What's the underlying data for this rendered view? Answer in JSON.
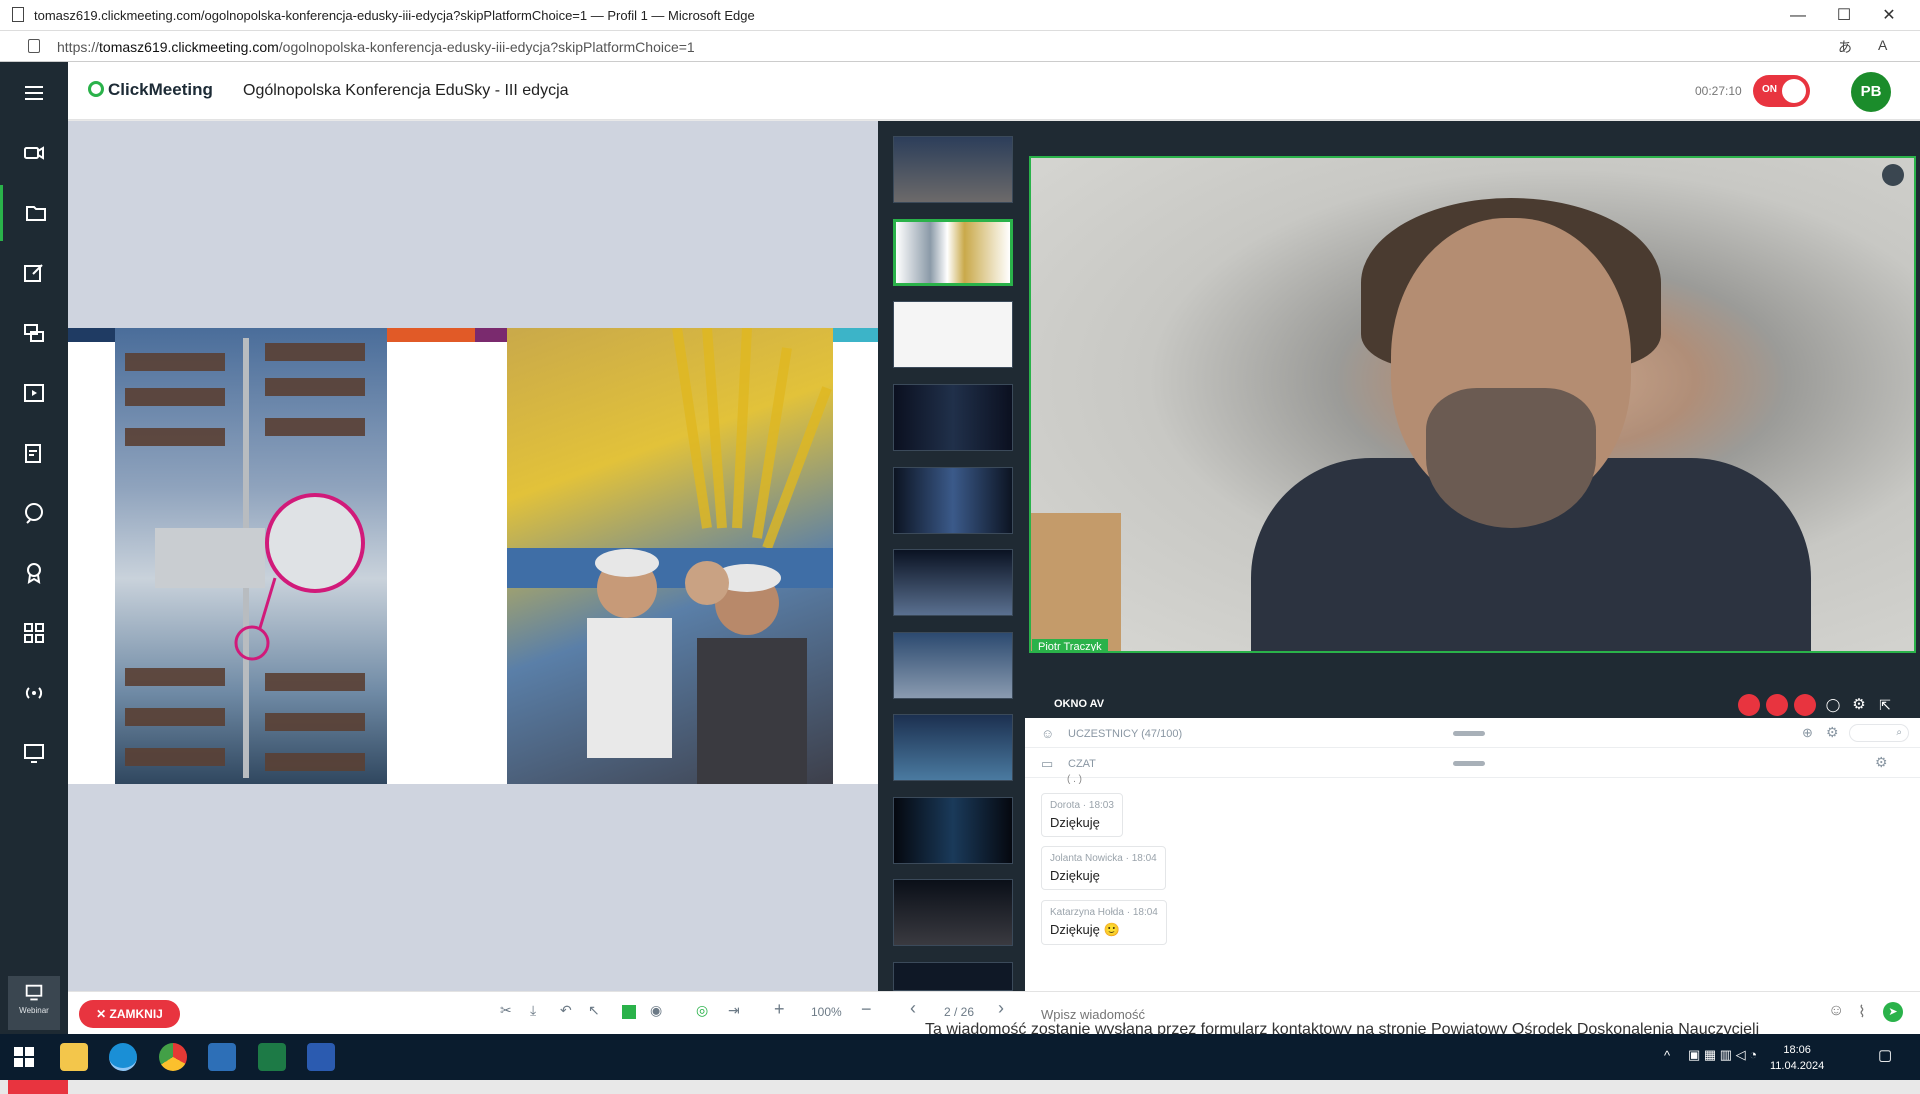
{
  "browser": {
    "title": "tomasz619.clickmeeting.com/ogolnopolska-konferencja-edusky-iii-edycja?skipPlatformChoice=1 — Profil 1 — Microsoft Edge",
    "url_scheme": "https://",
    "url_host": "tomasz619.clickmeeting.com",
    "url_path": "/ogolnopolska-konferencja-edusky-iii-edycja?skipPlatformChoice=1",
    "minimize": "—",
    "maximize": "☐",
    "close": "✕"
  },
  "header": {
    "logo": "ClickMeeting",
    "event_title": "Ogólnopolska Konferencja EduSky - III edycja",
    "timer": "00:27:10",
    "toggle_label": "ON",
    "avatar_initials": "PB"
  },
  "sidebar": {
    "items": [
      "menu",
      "camera",
      "files",
      "edit",
      "layers",
      "media",
      "survey",
      "qa",
      "badge",
      "apps",
      "broadcast",
      "screen"
    ],
    "webinar_label": "Webinar"
  },
  "presentation": {
    "slide_colors": [
      "#1f3b63",
      "#e15a27",
      "#7a2a6e",
      "#3cb4c8"
    ]
  },
  "video": {
    "participant_name": "Piotr Traczyk"
  },
  "av_panel": {
    "label": "OKNO AV"
  },
  "participants": {
    "label": "UCZESTNICY (47/100)"
  },
  "chat": {
    "label": "CZAT",
    "partial_top": "( . )",
    "messages": [
      {
        "author": "Dorota",
        "time": "18:03",
        "text": "Dziękuję"
      },
      {
        "author": "Jolanta Nowicka",
        "time": "18:04",
        "text": "Dziękuję"
      },
      {
        "author": "Katarzyna Hołda",
        "time": "18:04",
        "text": "Dziękuję",
        "emoji": "🙂"
      }
    ],
    "input_placeholder": "Wpisz wiadomość"
  },
  "toolbar": {
    "close_label": "ZAMKNIJ",
    "zoom": "100%",
    "page": "2 / 26"
  },
  "taskbar": {
    "time": "18:06",
    "date": "11.04.2024"
  },
  "background_text": "Ta wiadomość zostanie wysłana przez formularz kontaktowy na stronie Powiatowy Ośrodek Doskonalenia Nauczycieli"
}
